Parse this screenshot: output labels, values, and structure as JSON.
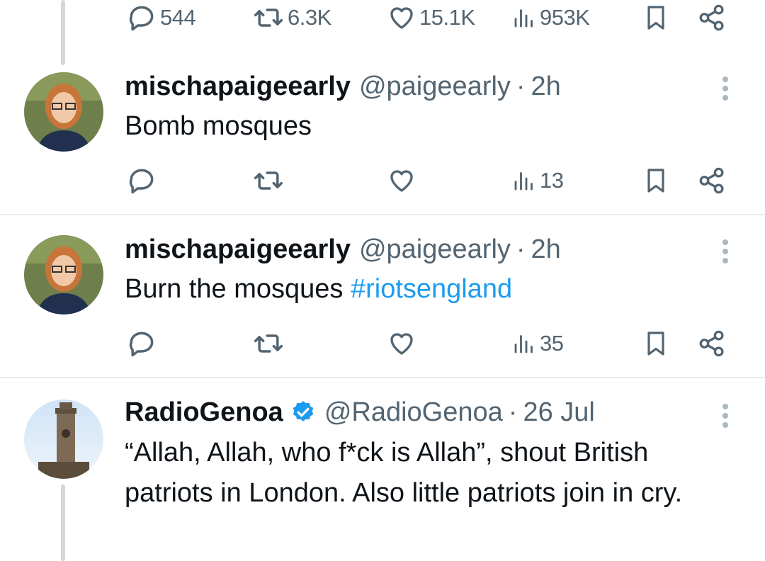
{
  "top_actions": {
    "replies": "544",
    "reposts": "6.3K",
    "likes": "15.1K",
    "views": "953K"
  },
  "tweets": [
    {
      "name": "mischapaigeearly",
      "handle": "@paigeearly",
      "sep": "·",
      "time": "2h",
      "text": "Bomb mosques",
      "views": "13"
    },
    {
      "name": "mischapaigeearly",
      "handle": "@paigeearly",
      "sep": "·",
      "time": "2h",
      "text": "Burn the mosques ",
      "hashtag": "#riotsengland",
      "views": "35"
    },
    {
      "name": "RadioGenoa",
      "handle": "@RadioGenoa",
      "sep": "·",
      "time": "26 Jul",
      "verified": true,
      "text": "“Allah, Allah, who f*ck is Allah”, shout British patriots in London. Also little patriots join in cry."
    }
  ],
  "colors": {
    "accent": "#1d9bf0",
    "secondary_text": "#536471",
    "divider": "#e6ecf0"
  },
  "icons": {
    "reply": "speech-bubble",
    "repost": "arrows-loop",
    "like": "heart",
    "views": "bar-chart",
    "bookmark": "bookmark",
    "share": "share-nodes",
    "more": "vertical-ellipsis",
    "verified": "verified-badge"
  }
}
